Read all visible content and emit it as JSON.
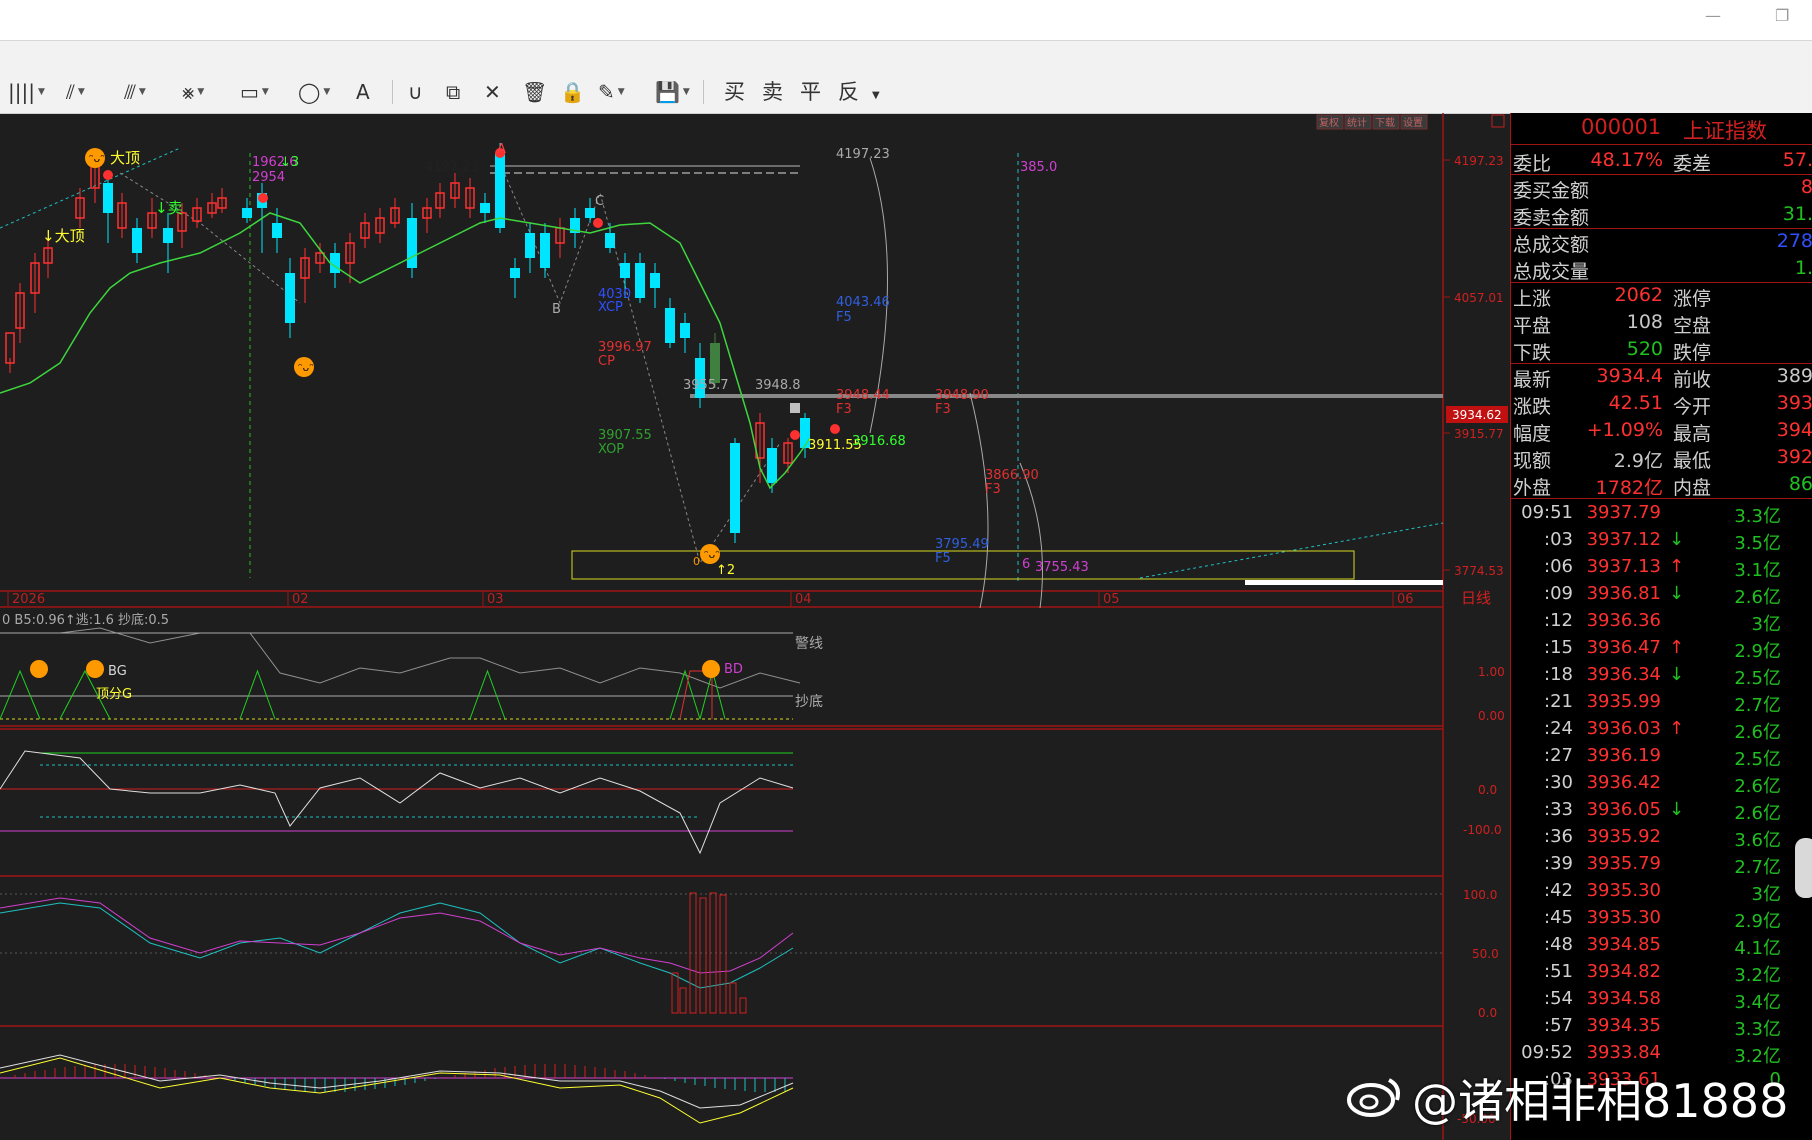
{
  "window": {
    "minimize_glyph": "—",
    "restore_glyph": "❐"
  },
  "toolbar": {
    "tools": [
      {
        "name": "vertical-lines-tool",
        "glyph": "||||"
      },
      {
        "name": "fan-lines-tool",
        "glyph": "⫽"
      },
      {
        "name": "parallel-lines-tool",
        "glyph": "⫻"
      },
      {
        "name": "fibonacci-tool",
        "glyph": "⨳"
      },
      {
        "name": "rectangle-tool",
        "glyph": "▭"
      },
      {
        "name": "ellipse-tool",
        "glyph": "◯"
      },
      {
        "name": "text-tool",
        "glyph": "A"
      },
      {
        "name": "magnet-tool",
        "glyph": "∪"
      },
      {
        "name": "copy-tool",
        "glyph": "⧉"
      },
      {
        "name": "delete-tool",
        "glyph": "✕"
      },
      {
        "name": "trash-tool",
        "glyph": "🗑"
      },
      {
        "name": "lock-tool",
        "glyph": "🔒"
      },
      {
        "name": "pen-tool",
        "glyph": "✎"
      },
      {
        "name": "save-tool",
        "glyph": "💾"
      }
    ],
    "trade_buttons": [
      "买",
      "卖",
      "平",
      "反"
    ]
  },
  "chart": {
    "buttons": [
      "复权",
      "统计",
      "下载",
      "设置"
    ],
    "price_axis": [
      "4197.23",
      "4057.01",
      "3915.77",
      "3774.53"
    ],
    "current_price": "3934.62",
    "date_axis": [
      "2026",
      "02",
      "03",
      "04",
      "05",
      "06"
    ],
    "period": "日线",
    "annotations": {
      "top_label": "大顶",
      "top_label2": "↓大顶",
      "sell_label": "↓卖",
      "peak_value": "1962.6",
      "peak_value2": "2954",
      "peak_arrow": "↓3",
      "hi_value": "4197.23",
      "hi_dash_value": "4197.23",
      "wave_A": "A",
      "wave_B": "B",
      "wave_C": "C",
      "purple_val": "385.0",
      "fib_4043": "4043.46",
      "fib_f5": "F5",
      "cp_label": "3996.97",
      "cp_tag": "CP",
      "blue_4030": "4030",
      "xcp": "XCP",
      "mid_3955": "3955.7",
      "mid_3948": "3948.8",
      "red_3948": "3948.44",
      "red_3948b": "3948.90",
      "f3": "F3",
      "green_3907": "3907.55",
      "xop": "XOP",
      "yellow_3911": "3911.55",
      "green_3916": "3916.68",
      "red_3866": "3866.90",
      "blue_3795": "3795.49",
      "red_3755": "3755.43",
      "six": "6",
      "arrow2": "↑2",
      "low_marker": "0"
    }
  },
  "indicator1": {
    "header": "0 B5:0.96↑逃:1.6 抄底:0.5",
    "label_alarm": "警线",
    "label_bottom": "抄底",
    "bg_label": "BG",
    "bd_label": "BD",
    "fen_label": "顶分G",
    "axis": [
      "1.00",
      "0.00"
    ]
  },
  "indicator2": {
    "axis": [
      "0.0",
      "-100.0"
    ]
  },
  "indicator3": {
    "axis": [
      "100.0",
      "50.0",
      "0.0"
    ]
  },
  "indicator4": {
    "axis": [
      "-50.00"
    ]
  },
  "quote": {
    "code": "000001",
    "name": "上证指数",
    "rows1": [
      {
        "label": "委比",
        "value": "48.17%",
        "label2": "委差",
        "value2": "57.",
        "color": "#ff3030",
        "color2": "#ff3030"
      }
    ],
    "rows2": [
      {
        "label": "委买金额",
        "value": "8",
        "color": "#ff3030"
      },
      {
        "label": "委卖金额",
        "value": "31.",
        "color": "#20c020"
      }
    ],
    "rows3": [
      {
        "label": "总成交额",
        "value": "278",
        "color": "#3050ff"
      },
      {
        "label": "总成交量",
        "value": "1.",
        "color": "#20c020"
      }
    ],
    "rows4": [
      {
        "label": "上涨",
        "value": "2062",
        "label2": "涨停",
        "color": "#ff3030"
      },
      {
        "label": "平盘",
        "value": "108",
        "label2": "空盘",
        "color": "#c8c8c8"
      },
      {
        "label": "下跌",
        "value": "520",
        "label2": "跌停",
        "color": "#20c020"
      }
    ],
    "rows5": [
      {
        "label": "最新",
        "value": "3934.4",
        "label2": "前收",
        "value2": "389",
        "color": "#ff3030",
        "color2": "#c8c8c8"
      },
      {
        "label": "涨跌",
        "value": "42.51",
        "label2": "今开",
        "value2": "393",
        "color": "#ff3030",
        "color2": "#ff3030"
      },
      {
        "label": "幅度",
        "value": "+1.09%",
        "label2": "最高",
        "value2": "394",
        "color": "#ff3030",
        "color2": "#ff3030"
      },
      {
        "label": "现额",
        "value": "2.9亿",
        "label2": "最低",
        "value2": "392",
        "color": "#c8c8c8",
        "color2": "#ff3030"
      },
      {
        "label": "外盘",
        "value": "1782亿",
        "label2": "内盘",
        "value2": "86",
        "color": "#ff3030",
        "color2": "#20c020"
      }
    ],
    "ticks": [
      {
        "t": "09:51",
        "p": "3937.79",
        "a": "",
        "v": "3.3亿"
      },
      {
        "t": ":03",
        "p": "3937.12",
        "a": "↓",
        "v": "3.5亿"
      },
      {
        "t": ":06",
        "p": "3937.13",
        "a": "↑",
        "v": "3.1亿"
      },
      {
        "t": ":09",
        "p": "3936.81",
        "a": "↓",
        "v": "2.6亿"
      },
      {
        "t": ":12",
        "p": "3936.36",
        "a": "",
        "v": "3亿"
      },
      {
        "t": ":15",
        "p": "3936.47",
        "a": "↑",
        "v": "2.9亿"
      },
      {
        "t": ":18",
        "p": "3936.34",
        "a": "↓",
        "v": "2.5亿"
      },
      {
        "t": ":21",
        "p": "3935.99",
        "a": "",
        "v": "2.7亿"
      },
      {
        "t": ":24",
        "p": "3936.03",
        "a": "↑",
        "v": "2.6亿"
      },
      {
        "t": ":27",
        "p": "3936.19",
        "a": "",
        "v": "2.5亿"
      },
      {
        "t": ":30",
        "p": "3936.42",
        "a": "",
        "v": "2.6亿"
      },
      {
        "t": ":33",
        "p": "3936.05",
        "a": "↓",
        "v": "2.6亿"
      },
      {
        "t": ":36",
        "p": "3935.92",
        "a": "",
        "v": "3.6亿"
      },
      {
        "t": ":39",
        "p": "3935.79",
        "a": "",
        "v": "2.7亿"
      },
      {
        "t": ":42",
        "p": "3935.30",
        "a": "",
        "v": "3亿"
      },
      {
        "t": ":45",
        "p": "3935.30",
        "a": "",
        "v": "2.9亿"
      },
      {
        "t": ":48",
        "p": "3934.85",
        "a": "",
        "v": "4.1亿"
      },
      {
        "t": ":51",
        "p": "3934.82",
        "a": "",
        "v": "3.2亿"
      },
      {
        "t": ":54",
        "p": "3934.58",
        "a": "",
        "v": "3.4亿"
      },
      {
        "t": ":57",
        "p": "3934.35",
        "a": "",
        "v": "3.3亿"
      },
      {
        "t": "09:52",
        "p": "3933.84",
        "a": "",
        "v": "3.2亿"
      },
      {
        "t": ":03",
        "p": "3933.61",
        "a": "",
        "v": "0"
      }
    ]
  },
  "watermark": "@诸相非相81888",
  "colors": {
    "up": "#ff3030",
    "down": "#00e5ff",
    "ma": "#3ed63e",
    "bg": "#1e1e1e",
    "grid": "#a01414"
  }
}
